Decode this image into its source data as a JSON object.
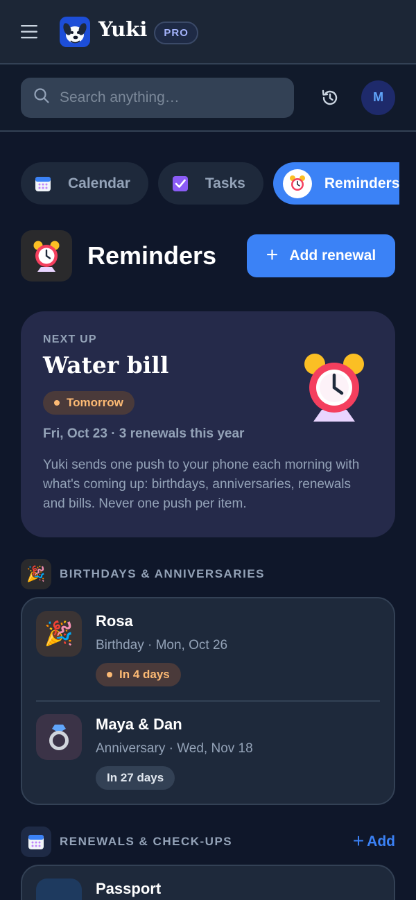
{
  "app": {
    "name": "Yuki",
    "badge": "PRO"
  },
  "search": {
    "placeholder": "Search anything…"
  },
  "user": {
    "initial": "M"
  },
  "tabs": [
    {
      "label": "Calendar",
      "icon": "calendar-icon"
    },
    {
      "label": "Tasks",
      "icon": "checkbox-icon"
    },
    {
      "label": "Reminders",
      "icon": "alarm-clock-icon",
      "active": true
    }
  ],
  "page": {
    "title": "Reminders",
    "add_button": "Add renewal"
  },
  "next_up": {
    "eyebrow": "NEXT UP",
    "title": "Water bill",
    "when": "Tomorrow",
    "meta": "Fri, Oct 23 · 3 renewals this year",
    "description": "Yuki sends one push to your phone each morning with what's coming up: birthdays, anniversaries, renewals and bills. Never one push per item."
  },
  "birthdays": {
    "title": "BIRTHDAYS & ANNIVERSARIES",
    "items": [
      {
        "name": "Rosa",
        "detail": "Birthday · Mon, Oct 26",
        "countdown": "In 4 days",
        "icon": "party-popper-icon"
      },
      {
        "name": "Maya & Dan",
        "detail": "Anniversary · Wed, Nov 18",
        "countdown": "In 27 days",
        "icon": "ring-icon"
      }
    ]
  },
  "renewals": {
    "title": "RENEWALS & CHECK-UPS",
    "add_label": "Add",
    "items": [
      {
        "name": "Passport"
      }
    ]
  },
  "colors": {
    "accent": "#3b82f6",
    "background": "#0f172a",
    "warm_badge": "#fdba74"
  }
}
